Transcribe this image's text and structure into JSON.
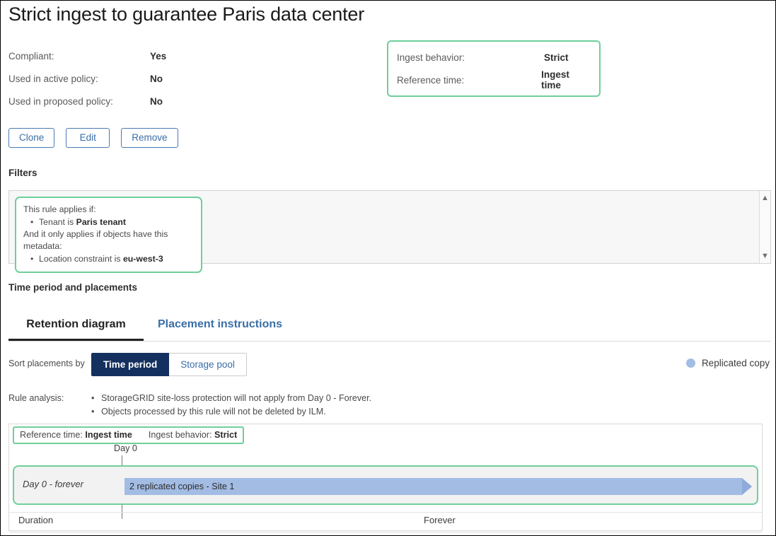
{
  "page": {
    "title": "Strict ingest to guarantee Paris data center"
  },
  "summary": {
    "rows": [
      {
        "label": "Compliant:",
        "value": "Yes"
      },
      {
        "label": "Used in active policy:",
        "value": "No"
      },
      {
        "label": "Used in proposed policy:",
        "value": "No"
      }
    ]
  },
  "ingest_box": {
    "rows": [
      {
        "label": "Ingest behavior:",
        "value": "Strict"
      },
      {
        "label": "Reference time:",
        "value": "Ingest time"
      }
    ],
    "border_color": "#6ecf9a"
  },
  "actions": {
    "clone_label": "Clone",
    "edit_label": "Edit",
    "remove_label": "Remove"
  },
  "filters": {
    "heading": "Filters",
    "intro": "This rule applies if:",
    "criteria": [
      {
        "prefix": "Tenant is ",
        "value": "Paris tenant"
      }
    ],
    "metadata_intro": "And it only applies if objects have this metadata:",
    "metadata": [
      {
        "prefix": "Location constraint is ",
        "value": "eu-west-3"
      }
    ],
    "scroll_up_icon": "chevron-up-icon",
    "scroll_down_icon": "chevron-down-icon"
  },
  "time_period": {
    "heading": "Time period and placements",
    "tabs": [
      {
        "label": "Retention diagram",
        "active": true
      },
      {
        "label": "Placement instructions",
        "active": false
      }
    ]
  },
  "sort": {
    "label": "Sort placements by",
    "options": [
      {
        "label": "Time period",
        "selected": true
      },
      {
        "label": "Storage pool",
        "selected": false
      }
    ],
    "selected_color": "#13305f"
  },
  "legend": {
    "items": [
      {
        "label": "Replicated copy",
        "color": "#a3bce4"
      }
    ]
  },
  "rule_analysis": {
    "label": "Rule analysis:",
    "items": [
      "StorageGRID site-loss protection will not apply from Day 0 - Forever.",
      "Objects processed by this rule will not be deleted by ILM."
    ]
  },
  "diagram": {
    "reference_chip": {
      "reference_label": "Reference time:",
      "reference_value": "Ingest time",
      "behavior_label": "Ingest behavior:",
      "behavior_value": "Strict"
    },
    "day0_label": "Day 0",
    "periods": [
      {
        "name": "Day 0 - forever",
        "placement": "2 replicated copies - Site 1",
        "bar_color": "#a3bce4"
      }
    ],
    "axis": {
      "duration_label": "Duration",
      "end_label": "Forever"
    }
  }
}
